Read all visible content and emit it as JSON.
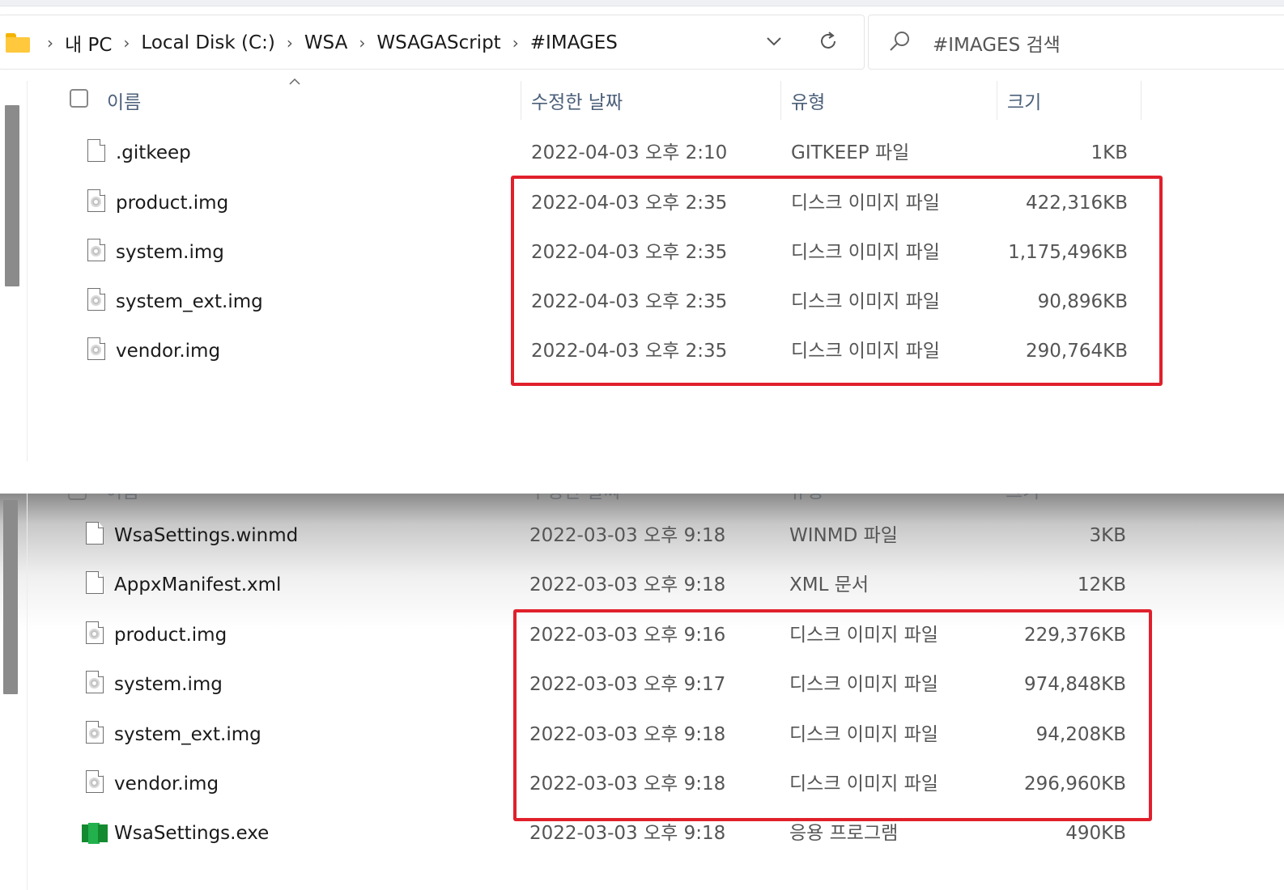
{
  "window1": {
    "breadcrumb": [
      "내 PC",
      "Local Disk (C:)",
      "WSA",
      "WSAGAScript",
      "#IMAGES"
    ],
    "breadcrumb_separator": "›",
    "search_placeholder": "#IMAGES 검색",
    "columns": {
      "name": "이름",
      "date": "수정한 날짜",
      "type": "유형",
      "size": "크기"
    },
    "files": [
      {
        "name": ".gitkeep",
        "date": "2022-04-03 오후 2:10",
        "type": "GITKEEP 파일",
        "size": "1KB",
        "icon": "file-icon"
      },
      {
        "name": "product.img",
        "date": "2022-04-03 오후 2:35",
        "type": "디스크 이미지 파일",
        "size": "422,316KB",
        "icon": "disc-image-icon"
      },
      {
        "name": "system.img",
        "date": "2022-04-03 오후 2:35",
        "type": "디스크 이미지 파일",
        "size": "1,175,496KB",
        "icon": "disc-image-icon"
      },
      {
        "name": "system_ext.img",
        "date": "2022-04-03 오후 2:35",
        "type": "디스크 이미지 파일",
        "size": "90,896KB",
        "icon": "disc-image-icon"
      },
      {
        "name": "vendor.img",
        "date": "2022-04-03 오후 2:35",
        "type": "디스크 이미지 파일",
        "size": "290,764KB",
        "icon": "disc-image-icon"
      }
    ]
  },
  "window2": {
    "columns": {
      "name": "이름",
      "date": "수정한 날짜",
      "type": "유형",
      "size": "크기"
    },
    "files": [
      {
        "name": "WsaSettings.winmd",
        "date": "2022-03-03 오후 9:18",
        "type": "WINMD 파일",
        "size": "3KB",
        "icon": "file-icon"
      },
      {
        "name": "AppxManifest.xml",
        "date": "2022-03-03 오후 9:18",
        "type": "XML 문서",
        "size": "12KB",
        "icon": "file-icon"
      },
      {
        "name": "product.img",
        "date": "2022-03-03 오후 9:16",
        "type": "디스크 이미지 파일",
        "size": "229,376KB",
        "icon": "disc-image-icon"
      },
      {
        "name": "system.img",
        "date": "2022-03-03 오후 9:17",
        "type": "디스크 이미지 파일",
        "size": "974,848KB",
        "icon": "disc-image-icon"
      },
      {
        "name": "system_ext.img",
        "date": "2022-03-03 오후 9:18",
        "type": "디스크 이미지 파일",
        "size": "94,208KB",
        "icon": "disc-image-icon"
      },
      {
        "name": "vendor.img",
        "date": "2022-03-03 오후 9:18",
        "type": "디스크 이미지 파일",
        "size": "296,960KB",
        "icon": "disc-image-icon"
      },
      {
        "name": "WsaSettings.exe",
        "date": "2022-03-03 오후 9:18",
        "type": "응용 프로그램",
        "size": "490KB",
        "icon": "app-exe-icon"
      }
    ]
  },
  "colors": {
    "highlight": "#e0202c",
    "header_text": "#4c607a",
    "folder": "#ffc83d"
  }
}
